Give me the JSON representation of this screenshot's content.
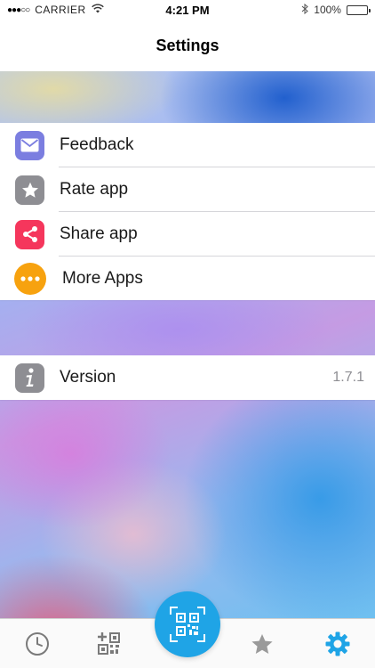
{
  "status_bar": {
    "signal": "●●●○○",
    "carrier": "CARRIER",
    "time": "4:21 PM",
    "battery": "100%",
    "battery_level": 1.0
  },
  "nav": {
    "title": "Settings"
  },
  "settings_group": {
    "items": [
      {
        "label": "Feedback",
        "icon": "envelope-icon",
        "color": "#7b7ee0"
      },
      {
        "label": "Rate app",
        "icon": "star-icon",
        "color": "#8e8e93"
      },
      {
        "label": "Share app",
        "icon": "share-icon",
        "color": "#f5365c"
      },
      {
        "label": "More Apps",
        "icon": "more-dots-icon",
        "color": "#f7a20f"
      }
    ]
  },
  "version_group": {
    "label": "Version",
    "value": "1.7.1",
    "icon": "info-icon",
    "color": "#8e8e93"
  },
  "tab_bar": {
    "tabs": [
      {
        "name": "history",
        "icon": "clock-icon",
        "active": false
      },
      {
        "name": "create",
        "icon": "qr-create-icon",
        "active": false
      },
      {
        "name": "scan",
        "icon": "qr-scan-icon",
        "active": false
      },
      {
        "name": "favorites",
        "icon": "star-icon",
        "active": false
      },
      {
        "name": "settings",
        "icon": "gear-icon",
        "active": true
      }
    ],
    "accent_color": "#1fa4e6",
    "inactive_color": "#7a7a7a"
  }
}
